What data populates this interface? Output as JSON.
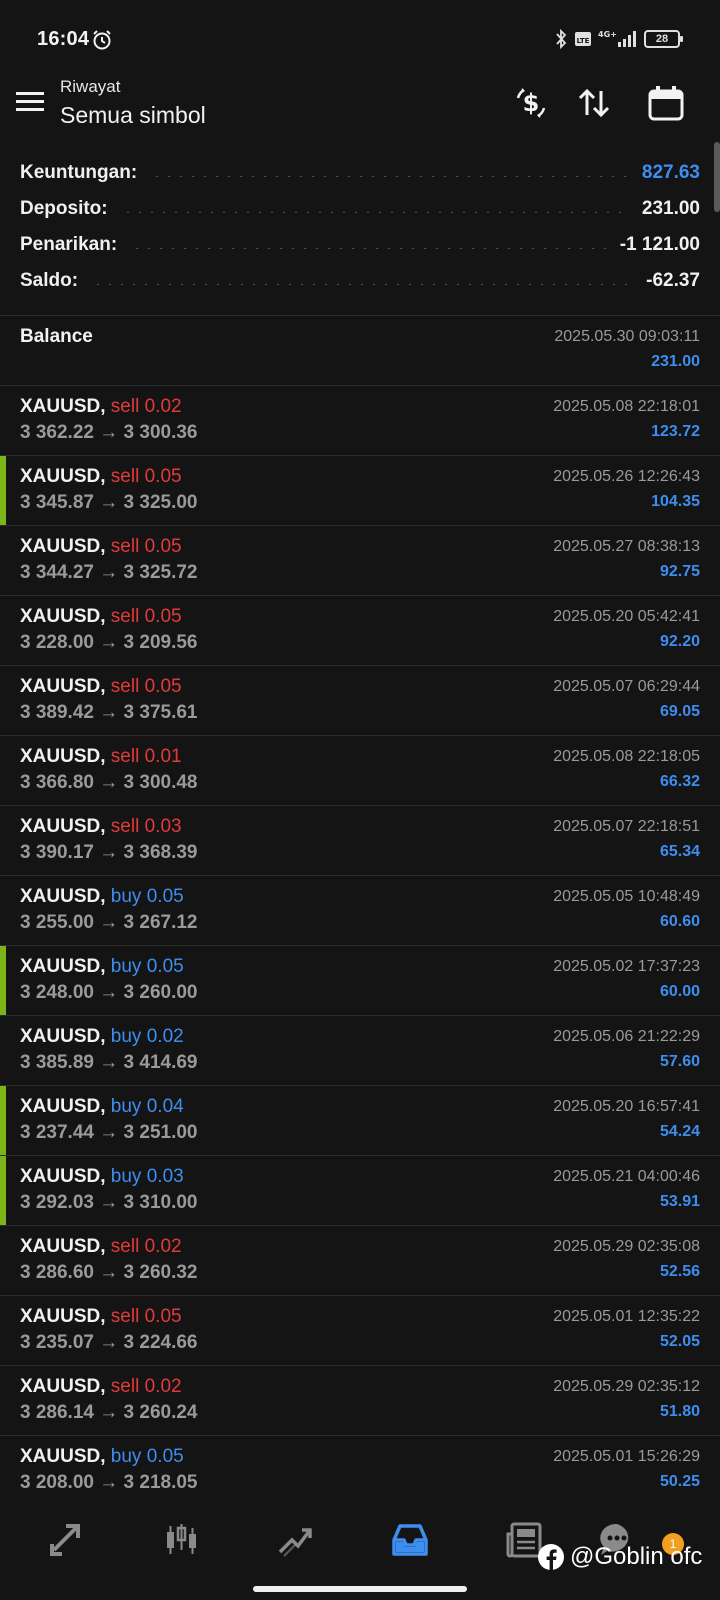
{
  "status_bar": {
    "time": "16:04",
    "battery": "28",
    "network": "4G+"
  },
  "header": {
    "subtitle": "Riwayat",
    "title": "Semua simbol"
  },
  "summary": [
    {
      "label": "Keuntungan:",
      "value": "827.63",
      "highlight": true
    },
    {
      "label": "Deposito:",
      "value": "231.00",
      "highlight": false
    },
    {
      "label": "Penarikan:",
      "value": "-1 121.00",
      "highlight": false
    },
    {
      "label": "Saldo:",
      "value": "-62.37",
      "highlight": false
    }
  ],
  "balance_entry": {
    "title": "Balance",
    "date": "2025.05.30 09:03:11",
    "amount": "231.00"
  },
  "trades": [
    {
      "symbol": "XAUUSD,",
      "type": "sell",
      "volume": "0.02",
      "open": "3 362.22",
      "close": "3 300.36",
      "date": "2025.05.08 22:18:01",
      "profit": "123.72",
      "marked": false
    },
    {
      "symbol": "XAUUSD,",
      "type": "sell",
      "volume": "0.05",
      "open": "3 345.87",
      "close": "3 325.00",
      "date": "2025.05.26 12:26:43",
      "profit": "104.35",
      "marked": true
    },
    {
      "symbol": "XAUUSD,",
      "type": "sell",
      "volume": "0.05",
      "open": "3 344.27",
      "close": "3 325.72",
      "date": "2025.05.27 08:38:13",
      "profit": "92.75",
      "marked": false
    },
    {
      "symbol": "XAUUSD,",
      "type": "sell",
      "volume": "0.05",
      "open": "3 228.00",
      "close": "3 209.56",
      "date": "2025.05.20 05:42:41",
      "profit": "92.20",
      "marked": false
    },
    {
      "symbol": "XAUUSD,",
      "type": "sell",
      "volume": "0.05",
      "open": "3 389.42",
      "close": "3 375.61",
      "date": "2025.05.07 06:29:44",
      "profit": "69.05",
      "marked": false
    },
    {
      "symbol": "XAUUSD,",
      "type": "sell",
      "volume": "0.01",
      "open": "3 366.80",
      "close": "3 300.48",
      "date": "2025.05.08 22:18:05",
      "profit": "66.32",
      "marked": false
    },
    {
      "symbol": "XAUUSD,",
      "type": "sell",
      "volume": "0.03",
      "open": "3 390.17",
      "close": "3 368.39",
      "date": "2025.05.07 22:18:51",
      "profit": "65.34",
      "marked": false
    },
    {
      "symbol": "XAUUSD,",
      "type": "buy",
      "volume": "0.05",
      "open": "3 255.00",
      "close": "3 267.12",
      "date": "2025.05.05 10:48:49",
      "profit": "60.60",
      "marked": false
    },
    {
      "symbol": "XAUUSD,",
      "type": "buy",
      "volume": "0.05",
      "open": "3 248.00",
      "close": "3 260.00",
      "date": "2025.05.02 17:37:23",
      "profit": "60.00",
      "marked": true
    },
    {
      "symbol": "XAUUSD,",
      "type": "buy",
      "volume": "0.02",
      "open": "3 385.89",
      "close": "3 414.69",
      "date": "2025.05.06 21:22:29",
      "profit": "57.60",
      "marked": false
    },
    {
      "symbol": "XAUUSD,",
      "type": "buy",
      "volume": "0.04",
      "open": "3 237.44",
      "close": "3 251.00",
      "date": "2025.05.20 16:57:41",
      "profit": "54.24",
      "marked": true
    },
    {
      "symbol": "XAUUSD,",
      "type": "buy",
      "volume": "0.03",
      "open": "3 292.03",
      "close": "3 310.00",
      "date": "2025.05.21 04:00:46",
      "profit": "53.91",
      "marked": true
    },
    {
      "symbol": "XAUUSD,",
      "type": "sell",
      "volume": "0.02",
      "open": "3 286.60",
      "close": "3 260.32",
      "date": "2025.05.29 02:35:08",
      "profit": "52.56",
      "marked": false
    },
    {
      "symbol": "XAUUSD,",
      "type": "sell",
      "volume": "0.05",
      "open": "3 235.07",
      "close": "3 224.66",
      "date": "2025.05.01 12:35:22",
      "profit": "52.05",
      "marked": false
    },
    {
      "symbol": "XAUUSD,",
      "type": "sell",
      "volume": "0.02",
      "open": "3 286.14",
      "close": "3 260.24",
      "date": "2025.05.29 02:35:12",
      "profit": "51.80",
      "marked": false
    },
    {
      "symbol": "XAUUSD,",
      "type": "buy",
      "volume": "0.05",
      "open": "3 208.00",
      "close": "3 218.05",
      "date": "2025.05.01 15:26:29",
      "profit": "50.25",
      "marked": false
    }
  ],
  "arrow": "→",
  "bottom_nav": {
    "items": [
      "quotes-icon",
      "chart-icon",
      "trade-icon",
      "history-icon",
      "news-icon",
      "chat-icon"
    ],
    "active": "history-icon",
    "badge": "1"
  },
  "watermark": "@Goblin ofc",
  "colors": {
    "background": "#141414",
    "accent": "#3d8ef0",
    "sell": "#e23a3a",
    "buy": "#3d8ef0",
    "marker": "#7cb518"
  }
}
